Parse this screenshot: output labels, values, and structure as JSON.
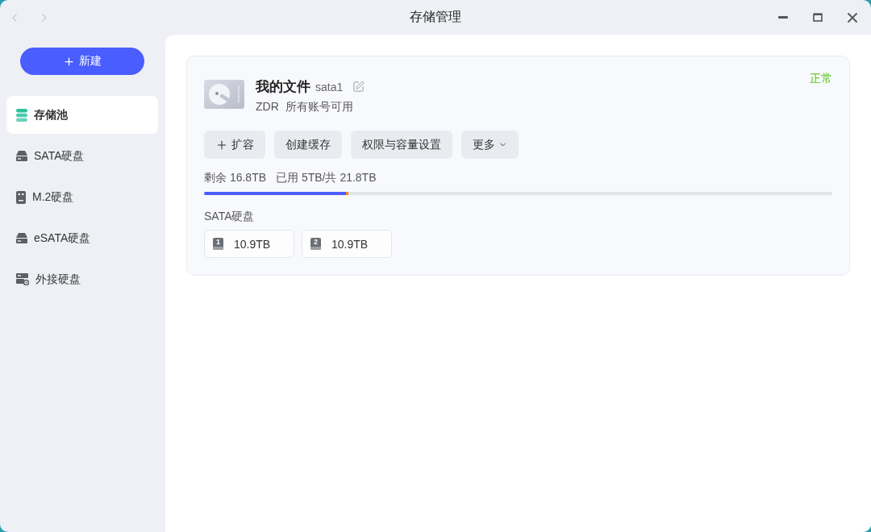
{
  "window": {
    "title": "存储管理",
    "nav": [
      {
        "kind": "back",
        "disabled": true
      },
      {
        "kind": "forward",
        "disabled": true
      }
    ]
  },
  "sidebar": {
    "new_button": {
      "label": "新建"
    },
    "items": [
      {
        "label": "存储池",
        "kind": "stack",
        "selected": true
      },
      {
        "label": "SATA硬盘",
        "kind": "drive",
        "selected": false
      },
      {
        "label": "M.2硬盘",
        "kind": "module",
        "selected": false
      },
      {
        "label": "eSATA硬盘",
        "kind": "drive",
        "selected": false
      },
      {
        "label": "外接硬盘",
        "kind": "enclosure",
        "selected": false
      }
    ]
  },
  "pool": {
    "name": "我的文件",
    "device": "sata1",
    "raid": "ZDR",
    "access": "所有账号可用",
    "status": "正常",
    "actions": [
      {
        "label": "扩容",
        "kind": "add"
      },
      {
        "label": "创建缓存",
        "kind": "plain"
      },
      {
        "label": "权限与容量设置",
        "kind": "plain"
      },
      {
        "label": "更多",
        "kind": "menu"
      }
    ],
    "usage": {
      "free": "剩余 16.8TB",
      "used": "已用 5TB/共 21.8TB",
      "level": 0.23
    },
    "disks": {
      "label": "SATA硬盘",
      "items": [
        {
          "slot": "1",
          "size": "10.9TB"
        },
        {
          "slot": "2",
          "size": "10.9TB"
        }
      ]
    }
  }
}
